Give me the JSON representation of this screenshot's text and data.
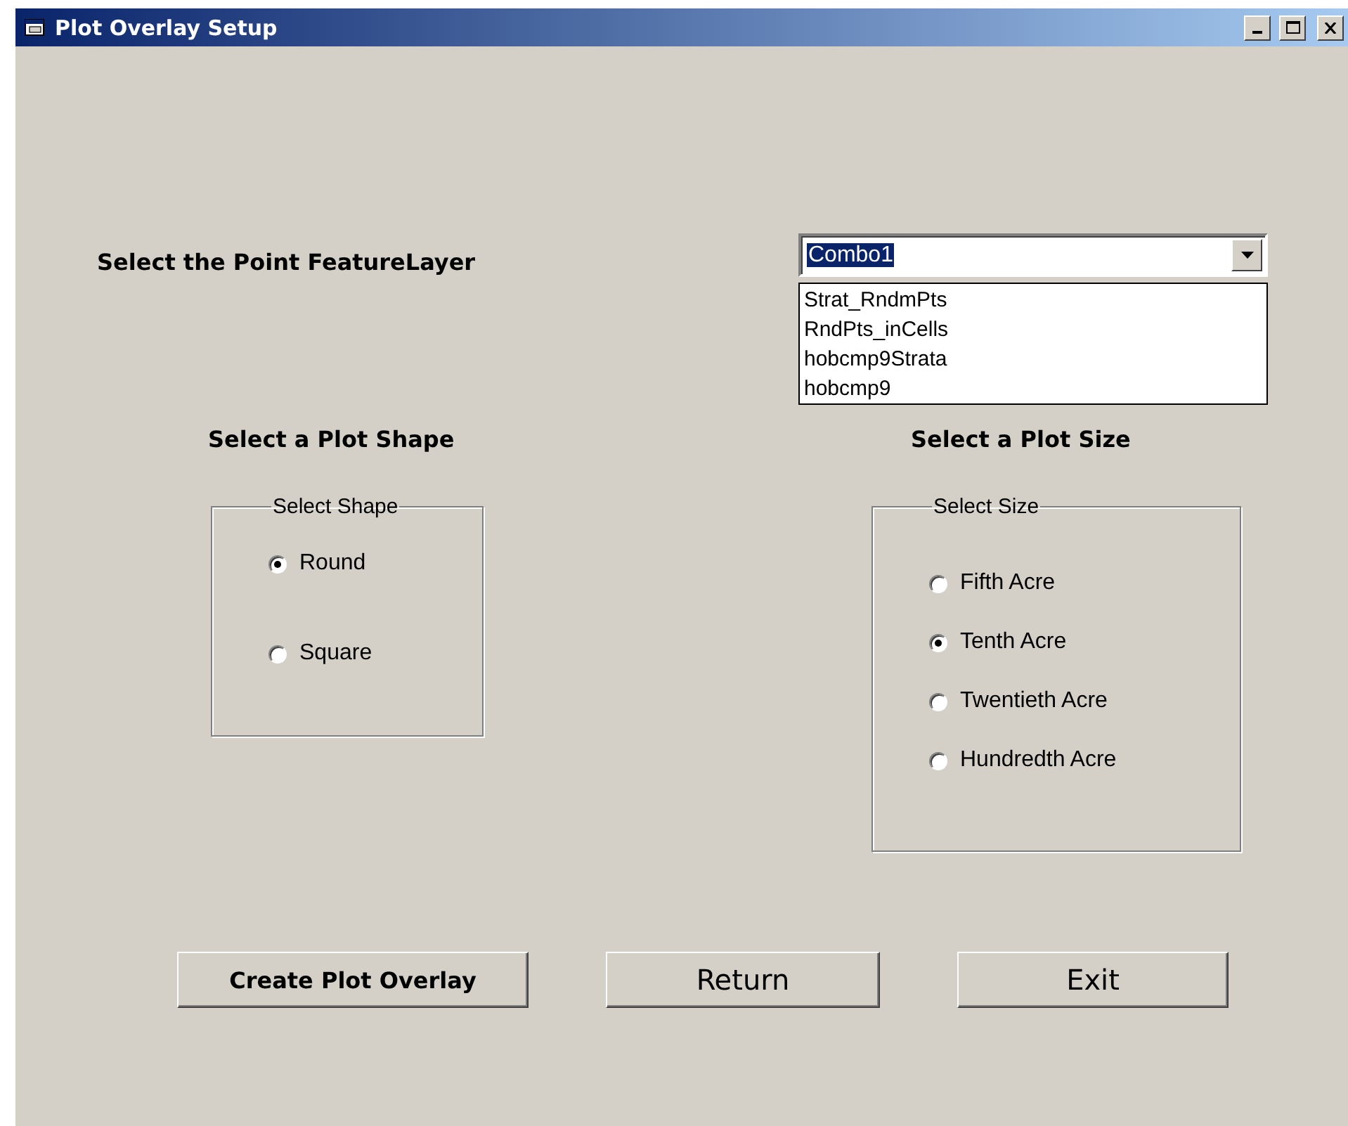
{
  "window": {
    "title": "Plot Overlay Setup"
  },
  "feature_layer": {
    "label": "Select the Point FeatureLayer",
    "combo": {
      "value": "Combo1",
      "options": [
        {
          "label": "Strat_RndmPts",
          "selected": false
        },
        {
          "label": "RndPts_inCells",
          "selected": false
        },
        {
          "label": "hobcmp9Strata",
          "selected": false
        },
        {
          "label": "hobcmp9",
          "selected": false
        }
      ]
    }
  },
  "shape": {
    "heading": "Select a Plot Shape",
    "frame_title": "Select Shape",
    "options": [
      {
        "label": "Round",
        "selected": true
      },
      {
        "label": "Square",
        "selected": false
      }
    ]
  },
  "size": {
    "heading": "Select a Plot Size",
    "frame_title": "Select Size",
    "options": [
      {
        "label": "Fifth Acre",
        "selected": false
      },
      {
        "label": "Tenth Acre",
        "selected": true
      },
      {
        "label": "Twentieth Acre",
        "selected": false
      },
      {
        "label": "Hundredth Acre",
        "selected": false
      }
    ]
  },
  "buttons": [
    "Create Plot Overlay",
    "Return",
    "Exit"
  ]
}
